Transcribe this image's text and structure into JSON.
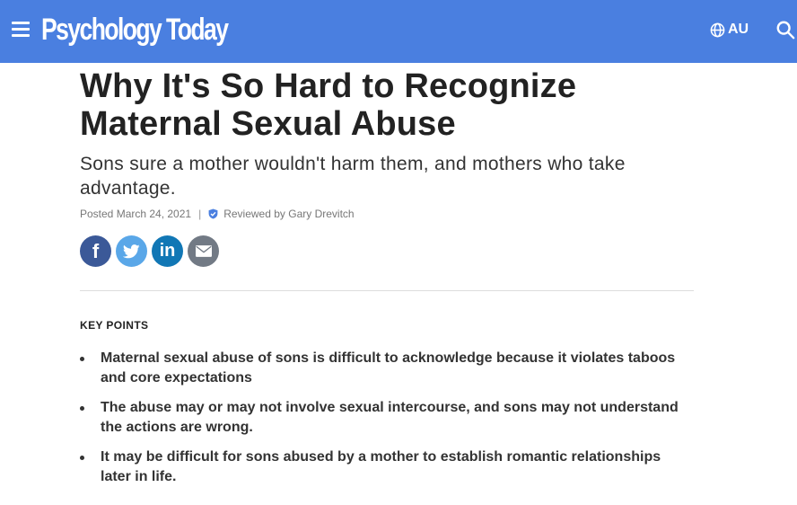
{
  "header": {
    "logo_text": "Psychology Today",
    "region_label": "AU",
    "brand_color": "#4a7fe0",
    "icons": [
      "menu-icon",
      "globe-icon",
      "search-icon"
    ]
  },
  "article": {
    "title": "Why It's So Hard to Recognize Maternal Sexual Abuse",
    "subtitle": "Sons sure a mother wouldn't harm them, and mothers who take advantage.",
    "posted": "Posted March 24, 2021",
    "separator": "|",
    "reviewed": "Reviewed by Gary Drevitch"
  },
  "share": {
    "facebook_glyph": "f",
    "linkedin_glyph": "in"
  },
  "key_points": {
    "heading": "KEY POINTS",
    "items": [
      "Maternal sexual abuse of sons is difficult to acknowledge because it violates taboos and core expectations",
      "The abuse may or may not involve sexual intercourse, and sons may not understand the actions are wrong.",
      "It may be difficult for sons abused by a mother to establish romantic relationships later in life."
    ]
  }
}
